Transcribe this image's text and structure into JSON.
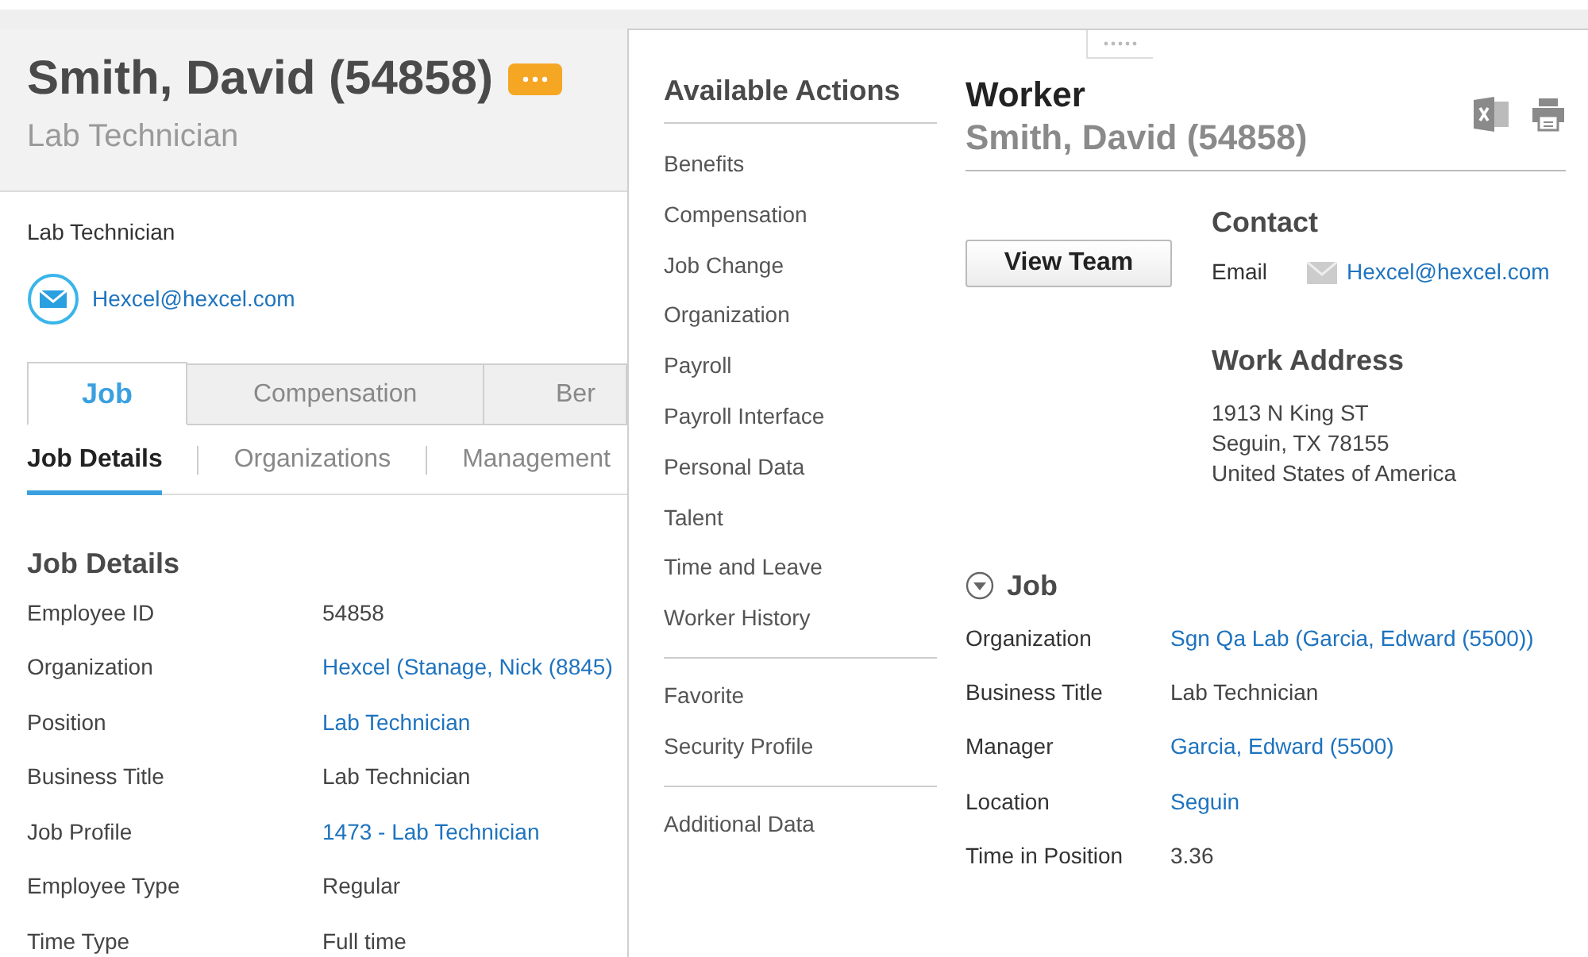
{
  "header": {
    "name": "Smith, David (54858)",
    "subtitle": "Lab Technician"
  },
  "profile": {
    "business_title": "Lab Technician",
    "email": "Hexcel@hexcel.com"
  },
  "tabs": [
    {
      "label": "Job",
      "selected": true
    },
    {
      "label": "Compensation",
      "selected": false
    },
    {
      "label": "Ber",
      "selected": false
    }
  ],
  "subtabs": [
    {
      "label": "Job Details",
      "selected": true
    },
    {
      "label": "Organizations",
      "selected": false
    },
    {
      "label": "Management",
      "selected": false
    }
  ],
  "job_details": {
    "title": "Job Details",
    "rows": [
      {
        "label": "Employee ID",
        "value": "54858",
        "kind": "text"
      },
      {
        "label": "Organization",
        "value": "Hexcel (Stanage, Nick (8845)",
        "kind": "link"
      },
      {
        "label": "Position",
        "value": "Lab Technician",
        "kind": "link"
      },
      {
        "label": "Business Title",
        "value": "Lab Technician",
        "kind": "text"
      },
      {
        "label": "Job Profile",
        "value": "1473 - Lab Technician",
        "kind": "link"
      },
      {
        "label": "Employee Type",
        "value": "Regular",
        "kind": "text"
      },
      {
        "label": "Time Type",
        "value": "Full time",
        "kind": "text"
      }
    ]
  },
  "popup": {
    "actions": {
      "title": "Available Actions",
      "groups": [
        [
          "Benefits",
          "Compensation",
          "Job Change",
          "Organization",
          "Payroll",
          "Payroll Interface",
          "Personal Data",
          "Talent",
          "Time and Leave",
          "Worker History"
        ],
        [
          "Favorite",
          "Security Profile"
        ],
        [
          "Additional Data"
        ]
      ]
    },
    "worker": {
      "title": "Worker",
      "name": "Smith, David (54858)"
    },
    "view_team_button": "View Team",
    "contact": {
      "title": "Contact",
      "email_label": "Email",
      "email": "Hexcel@hexcel.com"
    },
    "work_address": {
      "title": "Work Address",
      "lines": [
        "1913 N King ST",
        "Seguin, TX 78155",
        "United States of America"
      ]
    },
    "job": {
      "title": "Job",
      "expanded": true,
      "rows": [
        {
          "label": "Organization",
          "value": "Sgn Qa Lab (Garcia, Edward (5500))",
          "kind": "link"
        },
        {
          "label": "Business Title",
          "value": "Lab Technician",
          "kind": "text"
        },
        {
          "label": "Manager",
          "value": "Garcia, Edward (5500)",
          "kind": "link"
        },
        {
          "label": "Location",
          "value": "Seguin",
          "kind": "link"
        },
        {
          "label": "Time in Position",
          "value": "3.36",
          "kind": "text"
        }
      ]
    }
  }
}
